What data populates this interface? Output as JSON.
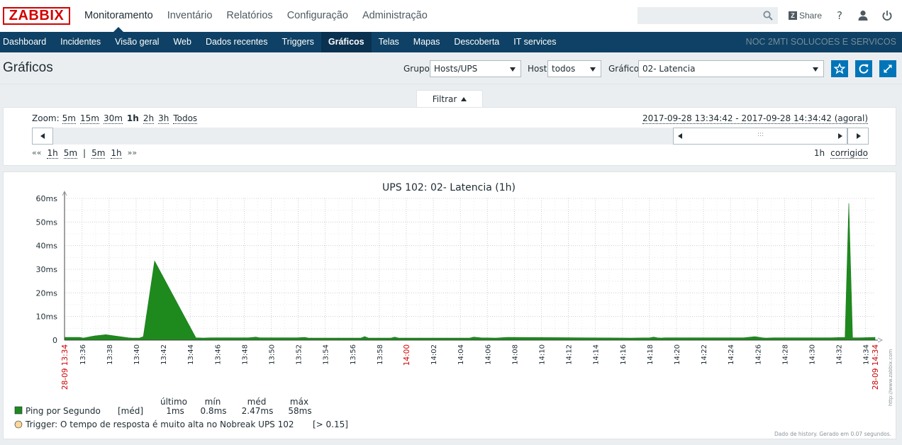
{
  "header": {
    "logo": "ZABBIX",
    "nav": [
      "Monitoramento",
      "Inventário",
      "Relatórios",
      "Configuração",
      "Administração"
    ],
    "active_nav": 0,
    "search_placeholder": "",
    "share_label": "Share",
    "help_label": "?"
  },
  "subnav": {
    "items": [
      "Dashboard",
      "Incidentes",
      "Visão geral",
      "Web",
      "Dados recentes",
      "Triggers",
      "Gráficos",
      "Telas",
      "Mapas",
      "Descoberta",
      "IT services"
    ],
    "active": 6,
    "server_name": "NOC 2MTI SOLUCOES E SERVICOS"
  },
  "page": {
    "title": "Gráficos",
    "group_label": "Grupo",
    "group_value": "Hosts/UPS",
    "host_label": "Host",
    "host_value": "todos",
    "graph_label": "Gráfico",
    "graph_value": "02- Latencia"
  },
  "filter": {
    "tab_label": "Filtrar",
    "zoom_label": "Zoom:",
    "zoom_options": [
      "5m",
      "15m",
      "30m",
      "1h",
      "2h",
      "3h",
      "Todos"
    ],
    "zoom_active": "1h",
    "period_text": "2017-09-28 13:34:42 - 2017-09-28 14:34:42 (agoral)",
    "nav_back_symbol": "««",
    "nav_back": [
      "1h",
      "5m"
    ],
    "nav_sep": "|",
    "nav_fwd": [
      "5m",
      "1h"
    ],
    "nav_fwd_symbol": "»»",
    "fixed_period": "1h",
    "fixed_label": "corrigido",
    "grip": ":::"
  },
  "colors": {
    "brand": "#d40000",
    "nav_bg": "#0e4165",
    "accent": "#0275b8",
    "series": "#1e8a1e",
    "trigger": "#ffd699",
    "red_label": "#cc0000"
  },
  "chart_data": {
    "type": "area",
    "title": "UPS 102: 02- Latencia (1h)",
    "y_ticks": [
      "60ms",
      "50ms",
      "40ms",
      "30ms",
      "20ms",
      "10ms",
      "0"
    ],
    "ylim": [
      0,
      60
    ],
    "y_unit": "ms",
    "x_tick_labels": [
      "28-09 13:34",
      "13:36",
      "13:38",
      "13:40",
      "13:42",
      "13:44",
      "13:46",
      "13:48",
      "13:50",
      "13:52",
      "13:54",
      "13:56",
      "13:58",
      "14:00",
      "14:02",
      "14:04",
      "14:06",
      "14:08",
      "14:10",
      "14:12",
      "14:14",
      "14:16",
      "14:18",
      "14:20",
      "14:22",
      "14:24",
      "14:26",
      "14:28",
      "14:30",
      "14:32",
      "14:34",
      "28-09 14:34"
    ],
    "x_tick_red": [
      "28-09 13:34",
      "14:00",
      "28-09 14:34"
    ],
    "xlim": [
      "13:34:42",
      "14:34:42"
    ],
    "grid": true,
    "series": [
      {
        "name": "Ping por Segundo",
        "func": "[méd]",
        "x_min": [
          0,
          4,
          5,
          8,
          11,
          17,
          18,
          20,
          21,
          24,
          35,
          37,
          39,
          49,
          51,
          52,
          62,
          64,
          65,
          79,
          80,
          81,
          87,
          88,
          89,
          108,
          109,
          111,
          115,
          118,
          151,
          156,
          157,
          158,
          159,
          160,
          181,
          184,
          186,
          187,
          189,
          204,
          208,
          209,
          210,
          212,
          216
        ],
        "values": [
          1.2,
          1.2,
          0.9,
          1.8,
          2.3,
          1.0,
          0.9,
          0.9,
          1.5,
          33.5,
          1.0,
          0.9,
          1.0,
          1.0,
          1.3,
          1.0,
          1.0,
          1.2,
          0.9,
          0.9,
          1.5,
          0.9,
          0.9,
          1.3,
          0.9,
          0.9,
          1.3,
          1.0,
          0.9,
          1.2,
          0.9,
          1.0,
          1.3,
          1.0,
          0.9,
          1.0,
          1.0,
          1.5,
          1.0,
          0.9,
          1.0,
          1.0,
          1.2,
          58.0,
          1.0,
          1.0,
          1.2
        ]
      }
    ],
    "legend": {
      "headers": [
        "último",
        "mín",
        "méd",
        "máx"
      ],
      "values": [
        "1ms",
        "0.8ms",
        "2.47ms",
        "58ms"
      ],
      "trigger_text": "Trigger: O tempo de resposta é muito alta no Nobreak UPS 102",
      "trigger_threshold": "[> 0.15]"
    },
    "watermark": "http://www.zabbix.com",
    "footer_note": "Dado de history. Gerado em 0.07 segundos."
  }
}
